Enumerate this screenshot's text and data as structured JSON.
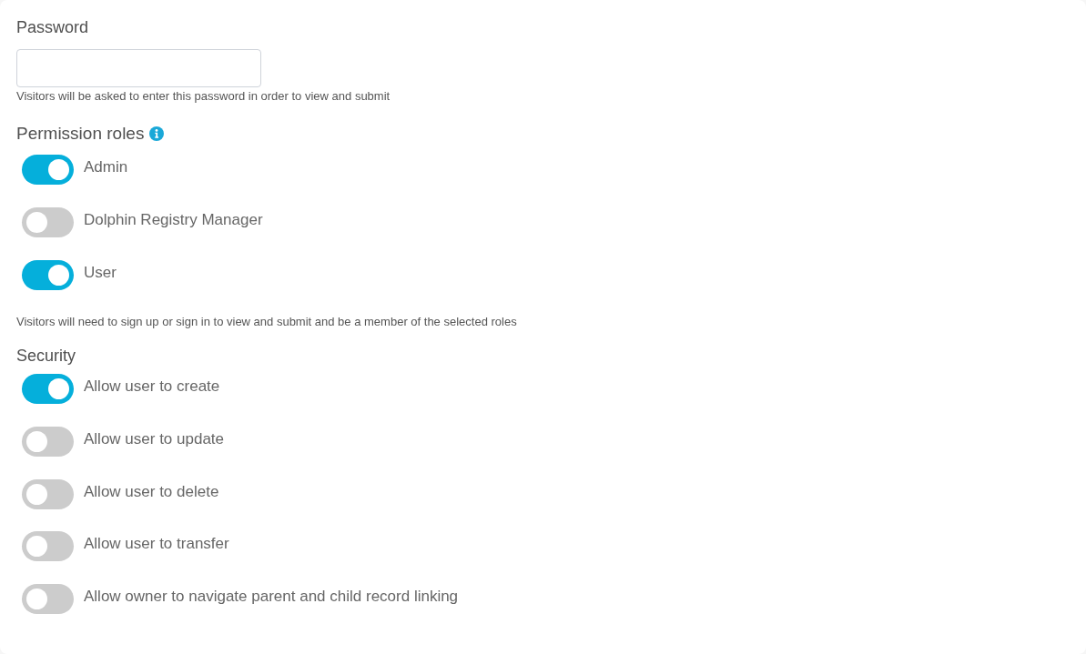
{
  "password": {
    "label": "Password",
    "hint": "Visitors will be asked to enter this password in order to view and submit"
  },
  "permission_roles": {
    "title": "Permission roles",
    "roles": [
      {
        "label": "Admin",
        "on": true
      },
      {
        "label": "Dolphin Registry Manager",
        "on": false
      },
      {
        "label": "User",
        "on": true
      }
    ],
    "hint": "Visitors will need to sign up or sign in to view and submit and be a member of the selected roles"
  },
  "security": {
    "title": "Security",
    "options": [
      {
        "label": "Allow user to create",
        "on": true
      },
      {
        "label": "Allow user to update",
        "on": false
      },
      {
        "label": "Allow user to delete",
        "on": false
      },
      {
        "label": "Allow user to transfer",
        "on": false
      },
      {
        "label": "Allow owner to navigate parent and child record linking",
        "on": false
      }
    ]
  }
}
